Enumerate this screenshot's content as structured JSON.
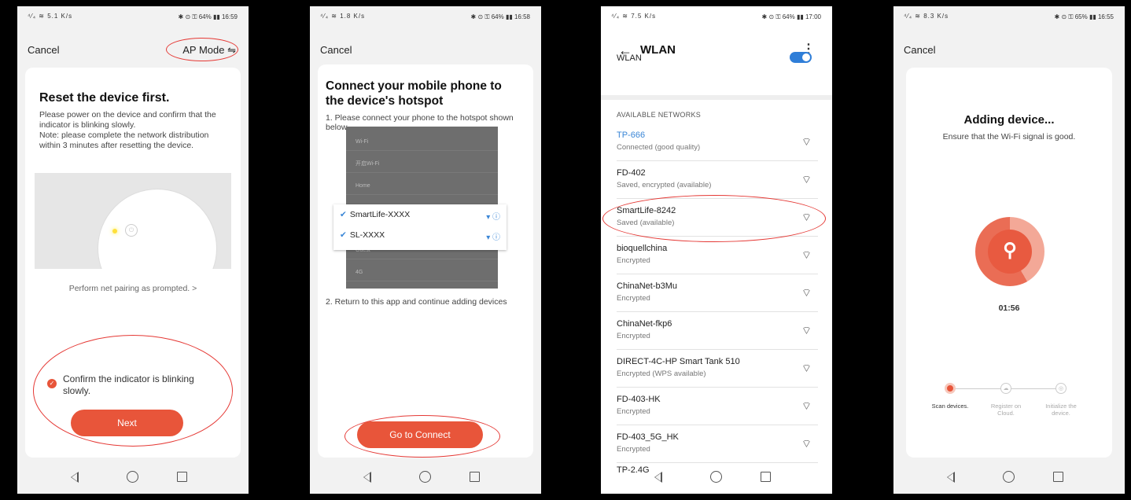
{
  "status_bars": [
    {
      "signal": "⁴⁄₄ ≋ 5.1 K/s",
      "right": "✱ ⊙ ⚿ 64% ▮▮ 16:59"
    },
    {
      "signal": "⁴⁄₄ ≋ 1.8 K/s",
      "right": "✱ ⊙ ⚿ 64% ▮▮ 16:58"
    },
    {
      "signal": "⁴⁄₄ ≋ 7.5 K/s",
      "right": "✱ ⊙ ⚿ 64% ▮▮ 17:00"
    },
    {
      "signal": "⁴⁄₄ ≋ 8.3 K/s",
      "right": "✱ ⊙ ⚿ 65% ▮▮ 16:55"
    }
  ],
  "screen1": {
    "cancel": "Cancel",
    "ap_mode": "AP Mode ⇋",
    "title": "Reset the device first.",
    "body": "Please power on the device and confirm that the indicator is blinking slowly.\nNote: please complete the network distribution within 3 minutes after resetting the device.",
    "prompt": "Perform net pairing as prompted. >",
    "confirm": "Confirm the indicator is blinking slowly.",
    "next": "Next"
  },
  "screen2": {
    "cancel": "Cancel",
    "title": "Connect your mobile phone to the device's hotspot",
    "step1": "1. Please connect your phone to the hotspot shown below",
    "step2": "2. Return to this app and continue adding devices",
    "shot_rows": [
      "Wi-Fi",
      "开启Wi-Fi",
      "Home",
      "",
      "",
      "Guest",
      "4G"
    ],
    "hotspots": [
      "SmartLife-XXXX",
      "SL-XXXX"
    ],
    "go": "Go to Connect"
  },
  "screen3": {
    "back": "←",
    "title": "WLAN",
    "menu": "⋮",
    "wlan_label": "WLAN",
    "section": "AVAILABLE NETWORKS",
    "networks": [
      {
        "name": "TP-666",
        "status": "Connected (good quality)"
      },
      {
        "name": "FD-402",
        "status": "Saved, encrypted (available)"
      },
      {
        "name": "SmartLife-8242",
        "status": "Saved (available)"
      },
      {
        "name": "bioquellchina",
        "status": "Encrypted"
      },
      {
        "name": "ChinaNet-b3Mu",
        "status": "Encrypted"
      },
      {
        "name": "ChinaNet-fkp6",
        "status": "Encrypted"
      },
      {
        "name": "DIRECT-4C-HP Smart Tank 510",
        "status": "Encrypted (WPS available)"
      },
      {
        "name": "FD-403-HK",
        "status": "Encrypted"
      },
      {
        "name": "FD-403_5G_HK",
        "status": "Encrypted"
      },
      {
        "name": "TP-2.4G",
        "status": ""
      }
    ],
    "wifi_glyph": "⌔"
  },
  "screen4": {
    "cancel": "Cancel",
    "title": "Adding device...",
    "subtitle": "Ensure that the Wi-Fi signal is good.",
    "timer": "01:56",
    "search_glyph": "⚲",
    "steps": [
      {
        "label": "Scan devices."
      },
      {
        "label": "Register on Cloud."
      },
      {
        "label": "Initialize the device."
      }
    ]
  },
  "colors": {
    "accent": "#e8553a",
    "highlight": "#e53935",
    "link": "#3a86d6"
  }
}
